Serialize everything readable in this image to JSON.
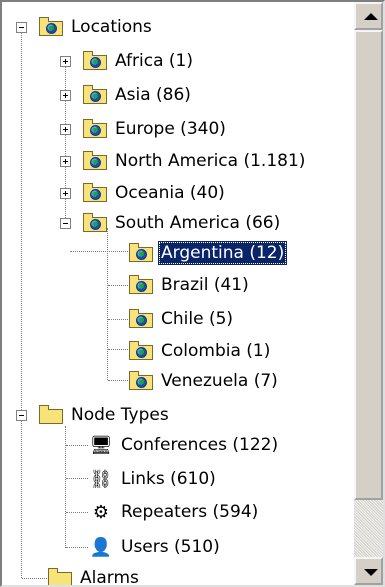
{
  "tree": {
    "locations": {
      "label": "Locations",
      "children": {
        "africa": "Africa (1)",
        "asia": "Asia (86)",
        "europe": "Europe (340)",
        "north_america": "North America (1.181)",
        "oceania": "Oceania (40)",
        "south_america": {
          "label": "South America (66)",
          "children": {
            "argentina": "Argentina (12)",
            "brazil": "Brazil (41)",
            "chile": "Chile (5)",
            "colombia": "Colombia (1)",
            "venezuela": "Venezuela (7)"
          }
        }
      }
    },
    "node_types": {
      "label": "Node Types",
      "children": {
        "conferences": "Conferences (122)",
        "links": "Links (610)",
        "repeaters": "Repeaters (594)",
        "users": "Users (510)"
      }
    },
    "alarms": "Alarms"
  },
  "selected_item": "Argentina (12)",
  "colors": {
    "selection": "#0a246a",
    "folder": "#f7e37a"
  }
}
